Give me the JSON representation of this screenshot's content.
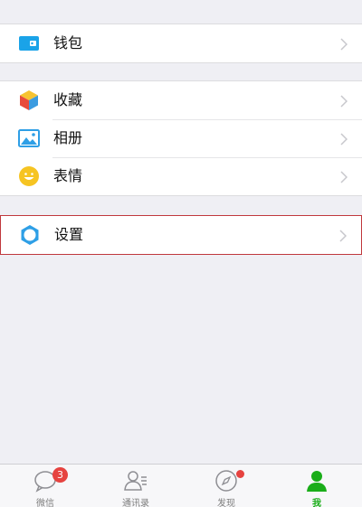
{
  "menu": {
    "wallet": {
      "label": "钱包"
    },
    "favorites": {
      "label": "收藏"
    },
    "album": {
      "label": "相册"
    },
    "stickers": {
      "label": "表情"
    },
    "settings": {
      "label": "设置"
    }
  },
  "tabbar": {
    "tabs": [
      {
        "label": "微信",
        "icon": "chat-bubble-icon",
        "badge": "3"
      },
      {
        "label": "通讯录",
        "icon": "contacts-icon"
      },
      {
        "label": "发现",
        "icon": "compass-icon",
        "dot": true
      },
      {
        "label": "我",
        "icon": "person-icon",
        "active": true
      }
    ]
  },
  "colors": {
    "accent": "#1aad19",
    "badge": "#e64340",
    "settings_border": "#c0383d",
    "background": "#efeff4"
  }
}
